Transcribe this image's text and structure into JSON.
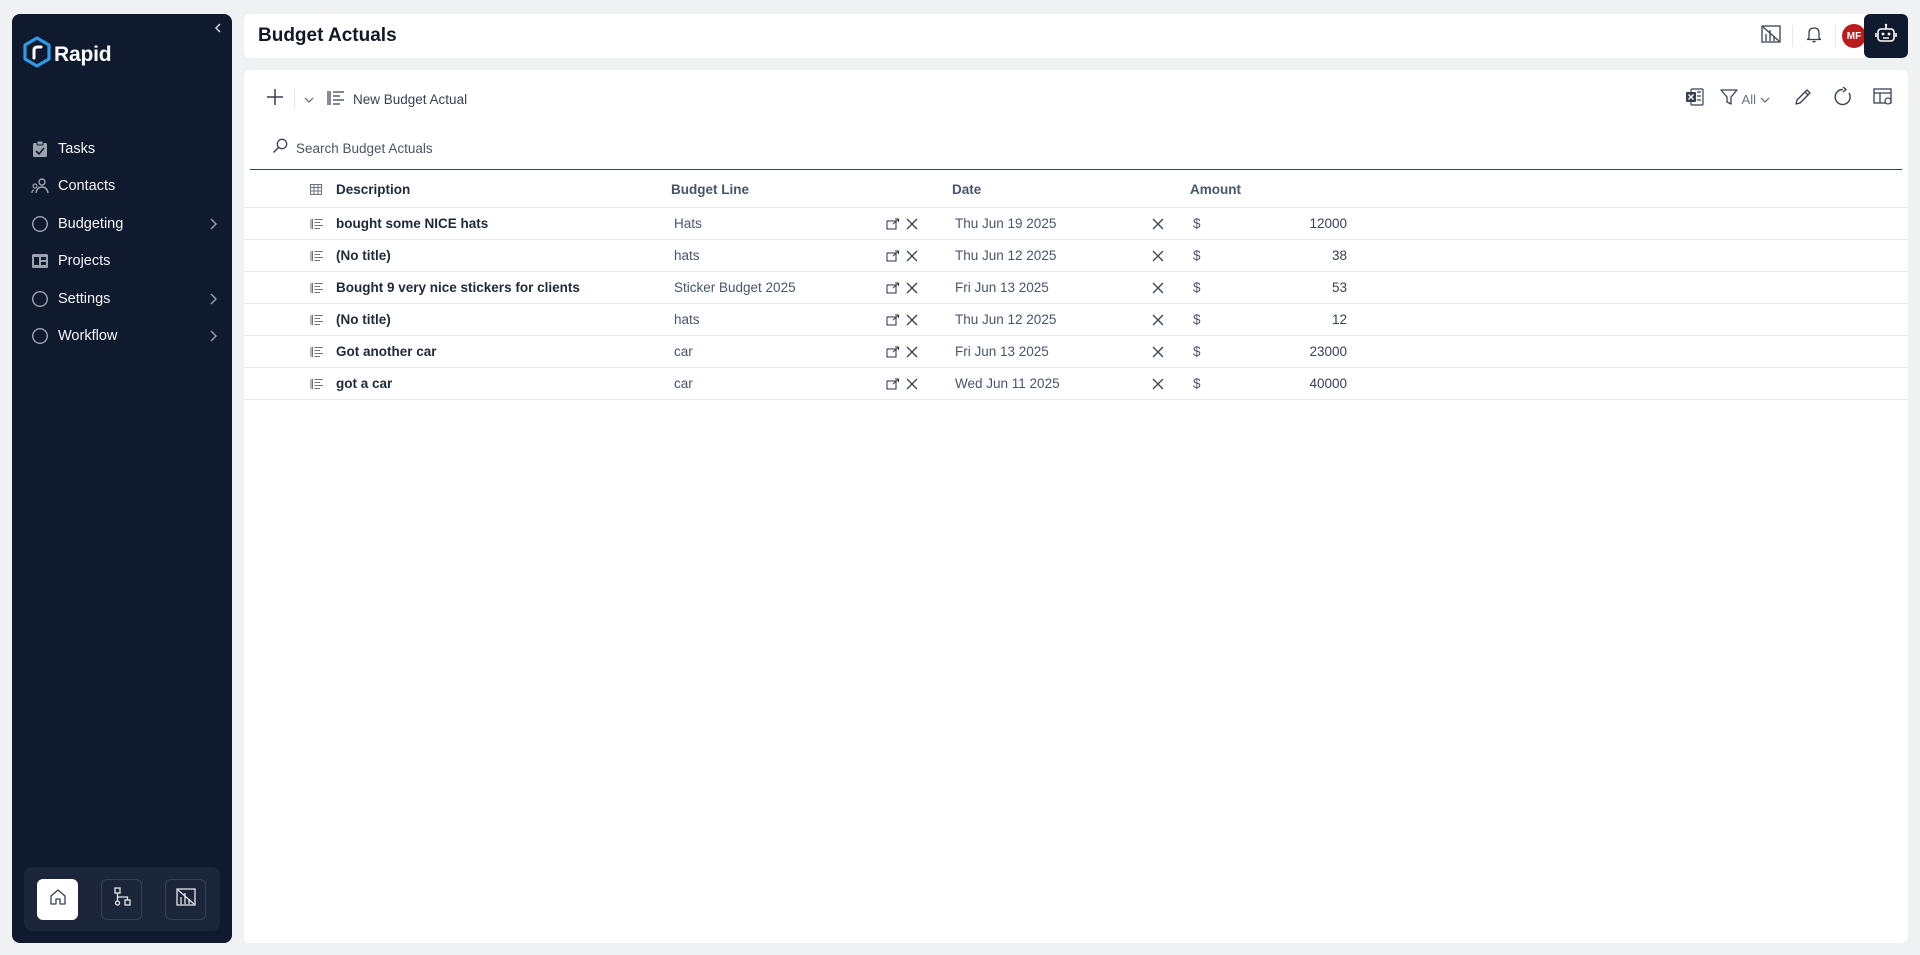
{
  "app": {
    "name": "Rapid"
  },
  "sidebar": {
    "items": [
      {
        "label": "Tasks",
        "icon": "clipboard-icon",
        "has_children": false
      },
      {
        "label": "Contacts",
        "icon": "contacts-icon",
        "has_children": false
      },
      {
        "label": "Budgeting",
        "icon": "circle-icon",
        "has_children": true
      },
      {
        "label": "Projects",
        "icon": "projects-icon",
        "has_children": false
      },
      {
        "label": "Settings",
        "icon": "circle-icon",
        "has_children": true
      },
      {
        "label": "Workflow",
        "icon": "circle-icon",
        "has_children": true
      }
    ],
    "bottom": [
      "home-icon",
      "workflow-diagram-icon",
      "report-icon"
    ]
  },
  "header": {
    "title": "Budget Actuals",
    "avatar_initials": "MF"
  },
  "toolbar": {
    "new_label": "New Budget Actual",
    "filter_label": "All"
  },
  "search": {
    "placeholder": "Search Budget Actuals"
  },
  "table": {
    "columns": {
      "description": "Description",
      "budget_line": "Budget Line",
      "date": "Date",
      "amount": "Amount"
    },
    "rows": [
      {
        "description": "bought some NICE hats",
        "budget_line": "Hats",
        "date": "Thu Jun 19 2025",
        "currency": "$",
        "amount": "12000"
      },
      {
        "description": "(No title)",
        "budget_line": "hats",
        "date": "Thu Jun 12 2025",
        "currency": "$",
        "amount": "38"
      },
      {
        "description": "Bought 9 very nice stickers for clients",
        "budget_line": "Sticker Budget 2025",
        "date": "Fri Jun 13 2025",
        "currency": "$",
        "amount": "53"
      },
      {
        "description": "(No title)",
        "budget_line": "hats",
        "date": "Thu Jun 12 2025",
        "currency": "$",
        "amount": "12"
      },
      {
        "description": "Got another car",
        "budget_line": "car",
        "date": "Fri Jun 13 2025",
        "currency": "$",
        "amount": "23000"
      },
      {
        "description": "got a car",
        "budget_line": "car",
        "date": "Wed Jun 11 2025",
        "currency": "$",
        "amount": "40000"
      }
    ]
  },
  "colors": {
    "sidebar_bg": "#101a2e",
    "avatar": "#b91c1c",
    "logo_accent": "#2f9be8"
  }
}
